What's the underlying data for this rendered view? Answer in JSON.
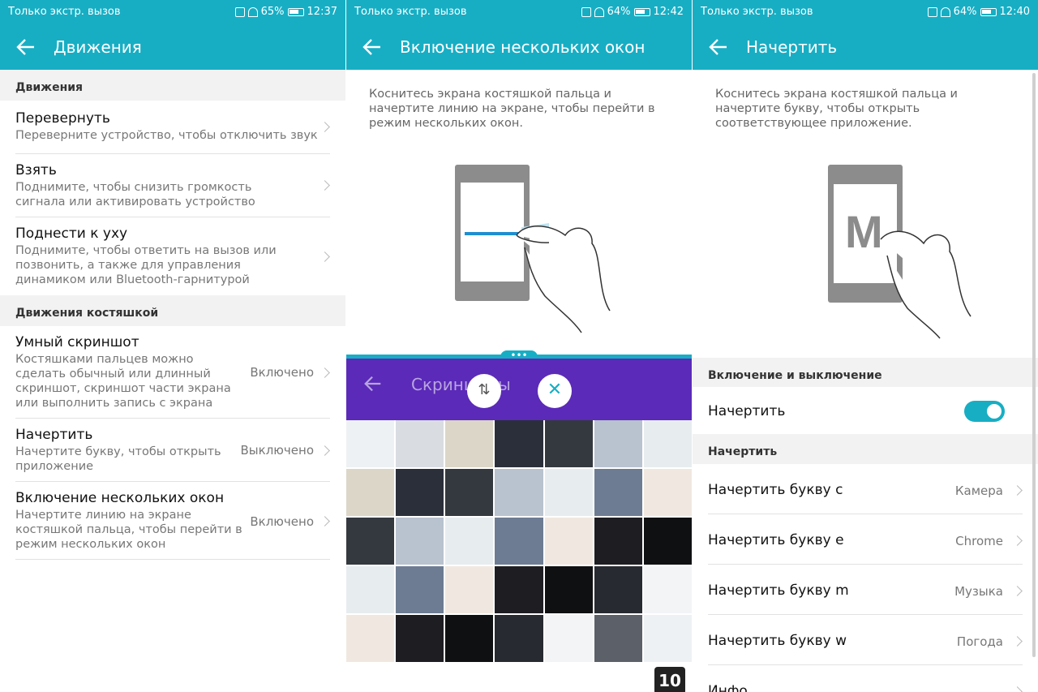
{
  "colors": {
    "accent": "#17aec4",
    "purple": "#5b2ab8"
  },
  "screen1": {
    "status": {
      "carrier": "Только экстр. вызов",
      "battery": "65%",
      "time": "12:37"
    },
    "title": "Движения",
    "section1": "Движения",
    "items1": [
      {
        "title": "Перевернуть",
        "desc": "Переверните устройство, чтобы отключить звук"
      },
      {
        "title": "Взять",
        "desc": "Поднимите, чтобы снизить громкость сигнала или активировать устройство"
      },
      {
        "title": "Поднести к уху",
        "desc": "Поднимите, чтобы ответить на вызов или позвонить, а также для управления динамиком или Bluetooth-гарнитурой"
      }
    ],
    "section2": "Движения костяшкой",
    "items2": [
      {
        "title": "Умный скриншот",
        "desc": "Костяшками пальцев можно сделать обычный или длинный скриншот, скриншот части экрана или выполнить запись с экрана",
        "value": "Включено"
      },
      {
        "title": "Начертить",
        "desc": "Начертите букву, чтобы открыть приложение",
        "value": "Выключено"
      },
      {
        "title": "Включение нескольких окон",
        "desc": "Начертите линию на экране костяшкой пальца, чтобы перейти в режим нескольких окон",
        "value": "Включено"
      }
    ]
  },
  "screen2": {
    "status": {
      "carrier": "Только экстр. вызов",
      "battery": "64%",
      "time": "12:42"
    },
    "title": "Включение нескольких окон",
    "desc": "Коснитесь экрана костяшкой пальца и начертите линию на экране, чтобы перейти в режим нескольких окон.",
    "split_title": "Скриншоты",
    "badge": "10"
  },
  "screen3": {
    "status": {
      "carrier": "Только экстр. вызов",
      "battery": "64%",
      "time": "12:40"
    },
    "title": "Начертить",
    "desc": "Коснитесь экрана костяшкой пальца и начертите букву, чтобы открыть соответствующее приложение.",
    "letter": "M",
    "section1": "Включение и выключение",
    "toggle_label": "Начертить",
    "toggle_on": true,
    "section2": "Начертить",
    "rows": [
      {
        "label": "Начертить букву c",
        "value": "Камера"
      },
      {
        "label": "Начертить букву e",
        "value": "Chrome"
      },
      {
        "label": "Начертить букву m",
        "value": "Музыка"
      },
      {
        "label": "Начертить букву w",
        "value": "Погода"
      },
      {
        "label": "Инфо",
        "value": ""
      }
    ]
  }
}
